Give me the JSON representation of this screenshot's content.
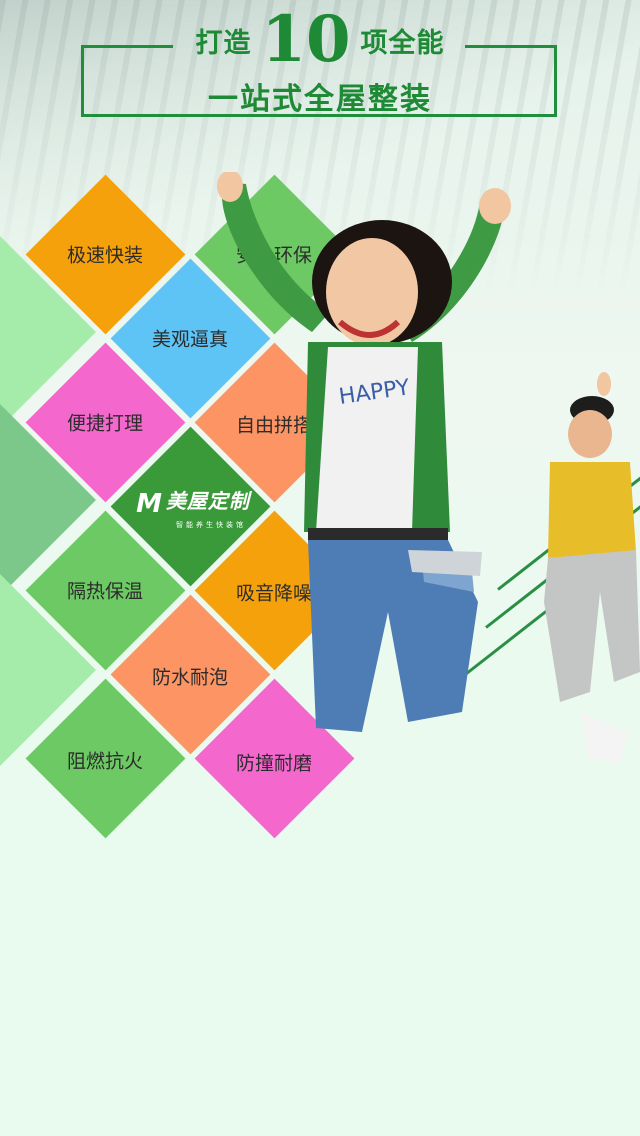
{
  "header": {
    "line1_prefix": "打造",
    "line1_number": "10",
    "line1_suffix": "项全能",
    "line2": "一站式全屋整装"
  },
  "features": [
    {
      "label": "极速快装",
      "color": "#f5a10c"
    },
    {
      "label": "安全环保",
      "color": "#6cc963"
    },
    {
      "label": "美观逼真",
      "color": "#5ec3f5"
    },
    {
      "label": "便捷打理",
      "color": "#f468ce"
    },
    {
      "label": "自由拼搭",
      "color": "#fc9563"
    },
    {
      "label": "隔热保温",
      "color": "#6cc963"
    },
    {
      "label": "吸音降噪",
      "color": "#f5a10c"
    },
    {
      "label": "防水耐泡",
      "color": "#fc9563"
    },
    {
      "label": "阻燃抗火",
      "color": "#6cc963"
    },
    {
      "label": "防撞耐磨",
      "color": "#f468ce"
    }
  ],
  "logo": {
    "name": "美屋定制",
    "tagline": "智能养生快装馆",
    "color": "#3a9a3a"
  }
}
